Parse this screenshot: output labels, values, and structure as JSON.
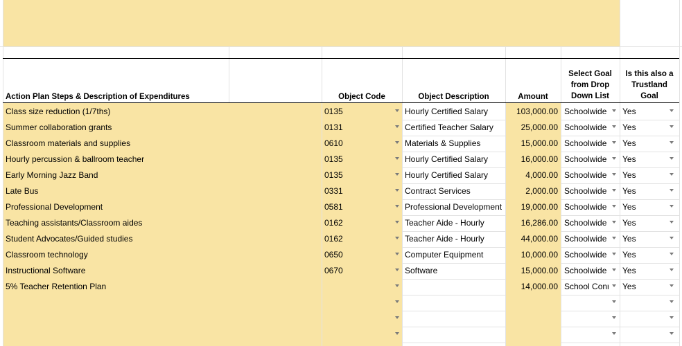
{
  "headers": {
    "steps": "Action Plan Steps & Description of Expenditures",
    "object_code": "Object Code",
    "object_description": "Object Description",
    "amount": "Amount",
    "select_goal": "Select Goal\nfrom Drop\nDown List",
    "trustland": "Is this also a\nTrustland\nGoal"
  },
  "rows": [
    {
      "step": "Class size reduction (1/7ths)",
      "code": "0135",
      "desc": "Hourly Certified Salary",
      "amount": "103,000.00",
      "goal": "Schoolwide",
      "trust": "Yes"
    },
    {
      "step": "Summer collaboration grants",
      "code": "0131",
      "desc": "Certified Teacher Salary",
      "amount": "25,000.00",
      "goal": "Schoolwide",
      "trust": "Yes"
    },
    {
      "step": "Classroom materials and supplies",
      "code": "0610",
      "desc": "Materials & Supplies",
      "amount": "15,000.00",
      "goal": "Schoolwide",
      "trust": "Yes"
    },
    {
      "step": "Hourly percussion & ballroom teacher",
      "code": "0135",
      "desc": "Hourly Certified Salary",
      "amount": "16,000.00",
      "goal": "Schoolwide",
      "trust": "Yes"
    },
    {
      "step": "Early Morning Jazz Band",
      "code": "0135",
      "desc": "Hourly Certified Salary",
      "amount": "4,000.00",
      "goal": "Schoolwide",
      "trust": "Yes"
    },
    {
      "step": "Late Bus",
      "code": "0331",
      "desc": "Contract Services",
      "amount": "2,000.00",
      "goal": "Schoolwide",
      "trust": "Yes"
    },
    {
      "step": "Professional Development",
      "code": "0581",
      "desc": "Professional Development",
      "amount": "19,000.00",
      "goal": "Schoolwide",
      "trust": "Yes"
    },
    {
      "step": "Teaching assistants/Classroom aides",
      "code": "0162",
      "desc": "Teacher Aide - Hourly",
      "amount": "16,286.00",
      "goal": "Schoolwide",
      "trust": "Yes"
    },
    {
      "step": "Student Advocates/Guided studies",
      "code": "0162",
      "desc": "Teacher Aide - Hourly",
      "amount": "44,000.00",
      "goal": "Schoolwide",
      "trust": "Yes"
    },
    {
      "step": "Classroom technology",
      "code": "0650",
      "desc": "Computer Equipment",
      "amount": "10,000.00",
      "goal": "Schoolwide",
      "trust": "Yes"
    },
    {
      "step": "Instructional Software",
      "code": "0670",
      "desc": "Software",
      "amount": "15,000.00",
      "goal": "Schoolwide",
      "trust": "Yes"
    },
    {
      "step": "5% Teacher Retention Plan",
      "code": "",
      "desc": "",
      "amount": "14,000.00",
      "goal": "School Conr",
      "trust": "Yes"
    },
    {
      "step": "",
      "code": "",
      "desc": "",
      "amount": "",
      "goal": "",
      "trust": ""
    },
    {
      "step": "",
      "code": "",
      "desc": "",
      "amount": "",
      "goal": "",
      "trust": ""
    },
    {
      "step": "",
      "code": "",
      "desc": "",
      "amount": "",
      "goal": "",
      "trust": ""
    }
  ]
}
